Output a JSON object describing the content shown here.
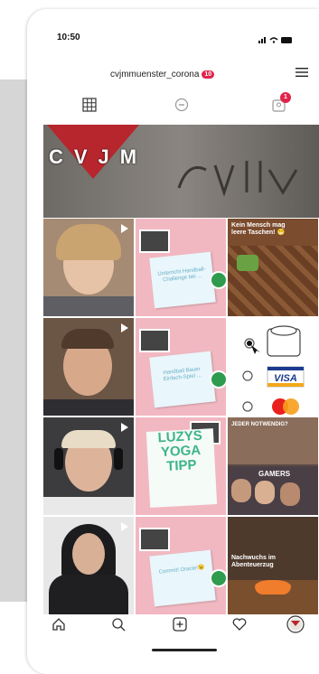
{
  "status_bar": {
    "time": "10:50"
  },
  "header": {
    "username": "cvjmmuenster_corona",
    "notification_count": "10"
  },
  "tabs": [
    {
      "icon": "grid-icon"
    },
    {
      "icon": "igtv-icon"
    },
    {
      "icon": "tagged-icon",
      "badge": "1"
    }
  ],
  "grid": {
    "banner_text": "CVJM",
    "cells": {
      "post_green_text": "Unterricht Handball-Challenge bei ...",
      "post_green2_text": "Handball Bauer Einfach-Spiel ...",
      "post_roof_text": "Kein Mensch mag leere Taschen! 😁",
      "yoga_lines": [
        "LUZYS",
        "YOGA",
        "TIPP"
      ],
      "post_green3_text": "Commit! Oracle!😉",
      "gamers_top": "JEDER NOTWENDIG?",
      "gamers_label": "GAMERS",
      "campfire_text": "Nachwuchs im Abenteuerzug"
    }
  },
  "colors": {
    "accent_red": "#e0234a",
    "teal": "#6ab0c8",
    "green": "#3eb48a"
  }
}
